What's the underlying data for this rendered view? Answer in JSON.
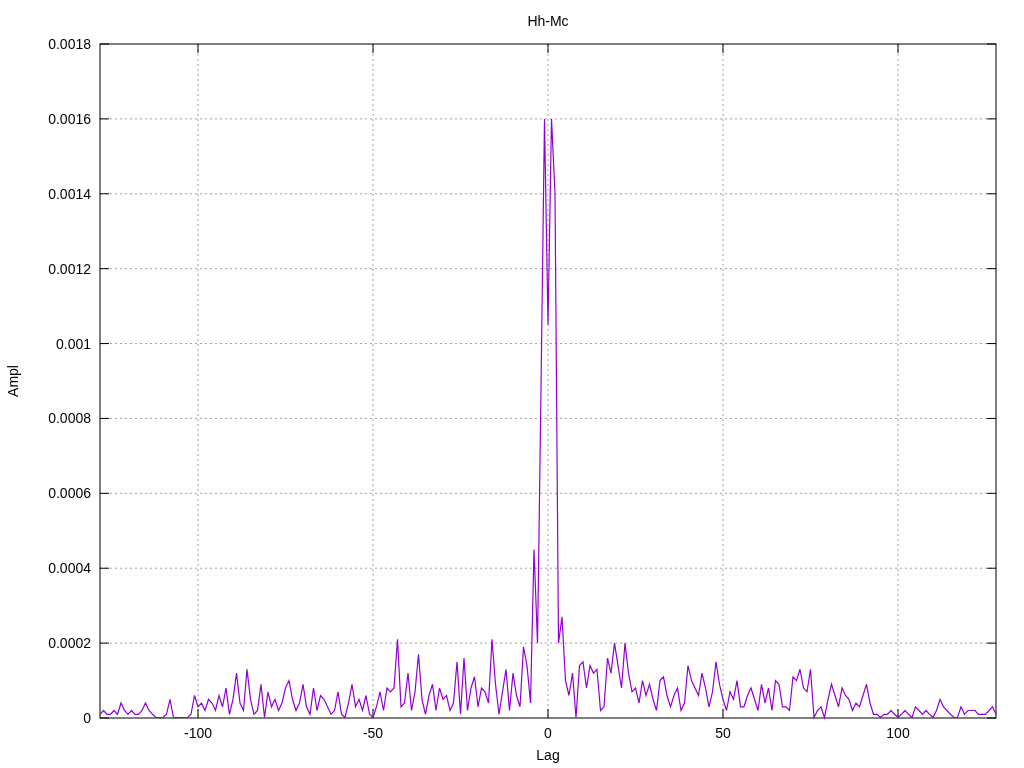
{
  "chart_data": {
    "type": "line",
    "title": "Hh-Mc",
    "xlabel": "Lag",
    "ylabel": "Ampl",
    "xlim": [
      -128,
      128
    ],
    "ylim": [
      0,
      0.0018
    ],
    "xticks": [
      -100,
      -50,
      0,
      50,
      100
    ],
    "yticks": [
      {
        "value": 0,
        "label": "0"
      },
      {
        "value": 0.0002,
        "label": "0.0002"
      },
      {
        "value": 0.0004,
        "label": "0.0004"
      },
      {
        "value": 0.0006,
        "label": "0.0006"
      },
      {
        "value": 0.0008,
        "label": "0.0008"
      },
      {
        "value": 0.001,
        "label": "0.001"
      },
      {
        "value": 0.0012,
        "label": "0.0012"
      },
      {
        "value": 0.0014,
        "label": "0.0014"
      },
      {
        "value": 0.0016,
        "label": "0.0016"
      },
      {
        "value": 0.0018,
        "label": "0.0018"
      }
    ],
    "grid": true,
    "x": [
      -128,
      -127,
      -126,
      -125,
      -124,
      -123,
      -122,
      -121,
      -120,
      -119,
      -118,
      -117,
      -116,
      -115,
      -114,
      -113,
      -112,
      -111,
      -110,
      -109,
      -108,
      -107,
      -106,
      -105,
      -104,
      -103,
      -102,
      -101,
      -100,
      -99,
      -98,
      -97,
      -96,
      -95,
      -94,
      -93,
      -92,
      -91,
      -90,
      -89,
      -88,
      -87,
      -86,
      -85,
      -84,
      -83,
      -82,
      -81,
      -80,
      -79,
      -78,
      -77,
      -76,
      -75,
      -74,
      -73,
      -72,
      -71,
      -70,
      -69,
      -68,
      -67,
      -66,
      -65,
      -64,
      -63,
      -62,
      -61,
      -60,
      -59,
      -58,
      -57,
      -56,
      -55,
      -54,
      -53,
      -52,
      -51,
      -50,
      -49,
      -48,
      -47,
      -46,
      -45,
      -44,
      -43,
      -42,
      -41,
      -40,
      -39,
      -38,
      -37,
      -36,
      -35,
      -34,
      -33,
      -32,
      -31,
      -30,
      -29,
      -28,
      -27,
      -26,
      -25,
      -24,
      -23,
      -22,
      -21,
      -20,
      -19,
      -18,
      -17,
      -16,
      -15,
      -14,
      -13,
      -12,
      -11,
      -10,
      -9,
      -8,
      -7,
      -6,
      -5,
      -4,
      -3,
      -2,
      -1,
      0,
      1,
      2,
      3,
      4,
      5,
      6,
      7,
      8,
      9,
      10,
      11,
      12,
      13,
      14,
      15,
      16,
      17,
      18,
      19,
      20,
      21,
      22,
      23,
      24,
      25,
      26,
      27,
      28,
      29,
      30,
      31,
      32,
      33,
      34,
      35,
      36,
      37,
      38,
      39,
      40,
      41,
      42,
      43,
      44,
      45,
      46,
      47,
      48,
      49,
      50,
      51,
      52,
      53,
      54,
      55,
      56,
      57,
      58,
      59,
      60,
      61,
      62,
      63,
      64,
      65,
      66,
      67,
      68,
      69,
      70,
      71,
      72,
      73,
      74,
      75,
      76,
      77,
      78,
      79,
      80,
      81,
      82,
      83,
      84,
      85,
      86,
      87,
      88,
      89,
      90,
      91,
      92,
      93,
      94,
      95,
      96,
      97,
      98,
      99,
      100,
      101,
      102,
      103,
      104,
      105,
      106,
      107,
      108,
      109,
      110,
      111,
      112,
      113,
      114,
      115,
      116,
      117,
      118,
      119,
      120,
      121,
      122,
      123,
      124,
      125,
      126,
      127,
      128
    ],
    "series": [
      {
        "color": "#9400d3",
        "values": [
          1e-05,
          2e-05,
          1e-05,
          1e-05,
          2e-05,
          1e-05,
          4e-05,
          2e-05,
          1e-05,
          2e-05,
          1e-05,
          1e-05,
          2e-05,
          4e-05,
          2e-05,
          1e-05,
          0,
          0,
          0,
          1e-05,
          5e-05,
          0,
          0,
          0,
          0,
          0,
          1e-05,
          6e-05,
          3e-05,
          4e-05,
          2e-05,
          5e-05,
          4e-05,
          2e-05,
          6e-05,
          3e-05,
          8e-05,
          1e-05,
          5e-05,
          0.00012,
          4e-05,
          2e-05,
          0.00013,
          5e-05,
          1e-05,
          2e-05,
          9e-05,
          0,
          7e-05,
          3e-05,
          5e-05,
          2e-05,
          4e-05,
          8e-05,
          0.0001,
          5e-05,
          2e-05,
          4e-05,
          9e-05,
          3e-05,
          1e-05,
          8e-05,
          2e-05,
          6e-05,
          5e-05,
          3e-05,
          1e-05,
          2e-05,
          7e-05,
          1e-05,
          0,
          4e-05,
          9e-05,
          3e-05,
          5e-05,
          2e-05,
          6e-05,
          1e-05,
          0,
          3e-05,
          7e-05,
          2e-05,
          8e-05,
          7e-05,
          8e-05,
          0.00021,
          3e-05,
          4e-05,
          0.00012,
          2e-05,
          7e-05,
          0.00017,
          5e-05,
          1e-05,
          6e-05,
          9e-05,
          2e-05,
          8e-05,
          5e-05,
          6e-05,
          2e-05,
          4e-05,
          0.00015,
          1e-05,
          0.00016,
          2e-05,
          8e-05,
          0.00011,
          3e-05,
          8e-05,
          7e-05,
          4e-05,
          0.00021,
          9e-05,
          1e-05,
          7e-05,
          0.00013,
          2e-05,
          0.00012,
          6e-05,
          3e-05,
          0.00019,
          0.00014,
          4e-05,
          0.00045,
          0.0002,
          0.00088,
          0.0016,
          0.00105,
          0.0016,
          0.0014,
          0.0002,
          0.00027,
          0.0001,
          6e-05,
          0.00012,
          0,
          0.00014,
          0.00015,
          8e-05,
          0.00014,
          0.00012,
          0.00013,
          2e-05,
          3e-05,
          0.00016,
          0.00012,
          0.0002,
          0.00014,
          8e-05,
          0.0002,
          0.00012,
          7e-05,
          8e-05,
          4e-05,
          0.0001,
          6e-05,
          9e-05,
          5e-05,
          2e-05,
          0.0001,
          0.00011,
          6e-05,
          3e-05,
          6e-05,
          8e-05,
          2e-05,
          4e-05,
          0.00014,
          0.0001,
          8e-05,
          6e-05,
          0.00012,
          8e-05,
          3e-05,
          7e-05,
          0.00015,
          9e-05,
          5e-05,
          2e-05,
          7e-05,
          5e-05,
          0.0001,
          3e-05,
          3e-05,
          6e-05,
          8e-05,
          5e-05,
          2e-05,
          9e-05,
          4e-05,
          8e-05,
          2e-05,
          0.0001,
          9e-05,
          3e-05,
          3e-05,
          2e-05,
          0.00011,
          0.0001,
          0.00013,
          8e-05,
          7e-05,
          0.00013,
          0,
          2e-05,
          3e-05,
          0,
          5e-05,
          9e-05,
          6e-05,
          3e-05,
          8e-05,
          6e-05,
          5e-05,
          2e-05,
          4e-05,
          3e-05,
          6e-05,
          9e-05,
          4e-05,
          1e-05,
          1e-05,
          0,
          1e-05,
          1e-05,
          2e-05,
          1e-05,
          0,
          1e-05,
          2e-05,
          1e-05,
          0,
          3e-05,
          2e-05,
          1e-05,
          2e-05,
          1e-05,
          0,
          2e-05,
          5e-05,
          3e-05,
          2e-05,
          1e-05,
          0,
          0,
          3e-05,
          1e-05,
          2e-05,
          2e-05,
          2e-05,
          1e-05,
          1e-05,
          1e-05,
          2e-05,
          3e-05,
          1e-05
        ]
      }
    ]
  }
}
